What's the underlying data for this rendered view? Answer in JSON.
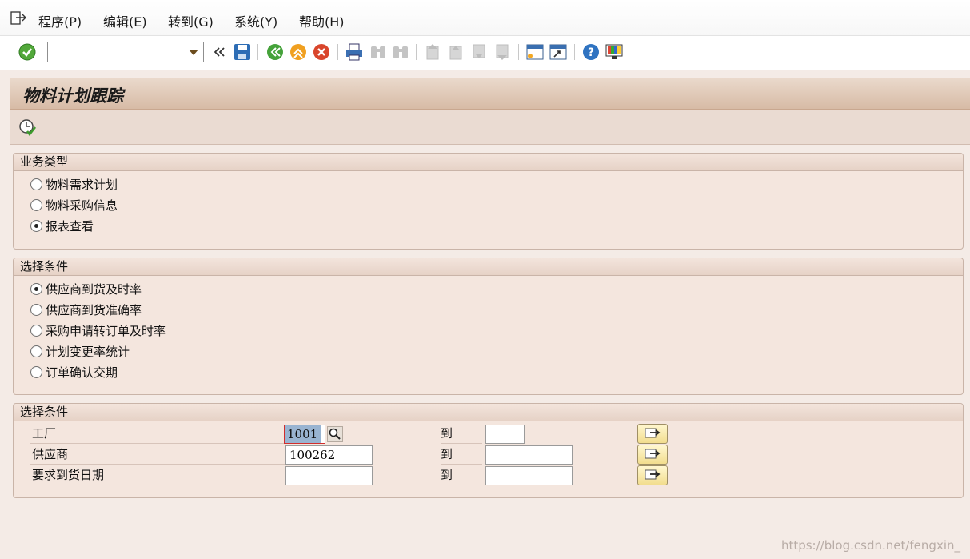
{
  "menubar": {
    "items": [
      "程序(P)",
      "编辑(E)",
      "转到(G)",
      "系统(Y)",
      "帮助(H)"
    ]
  },
  "toolbar": {
    "command_value": "",
    "icons": [
      "enter-icon",
      "back-icon",
      "save-icon",
      "back-green-icon",
      "exit-icon",
      "cancel-icon",
      "print-icon",
      "find-icon",
      "find-next-icon",
      "first-page-icon",
      "prev-page-icon",
      "next-page-icon",
      "last-page-icon",
      "new-session-icon",
      "shortcut-icon",
      "help-icon",
      "layout-icon"
    ]
  },
  "page": {
    "title": "物料计划跟踪",
    "execute_icon": "execute-icon"
  },
  "group_business": {
    "header": "业务类型",
    "options": [
      {
        "label": "物料需求计划",
        "checked": false
      },
      {
        "label": "物料采购信息",
        "checked": false
      },
      {
        "label": "报表查看",
        "checked": true
      }
    ]
  },
  "group_conditions": {
    "header": "选择条件",
    "options": [
      {
        "label": "供应商到货及时率",
        "checked": true
      },
      {
        "label": "供应商到货准确率",
        "checked": false
      },
      {
        "label": "采购申请转订单及时率",
        "checked": false
      },
      {
        "label": "计划变更率统计",
        "checked": false
      },
      {
        "label": "订单确认交期",
        "checked": false
      }
    ]
  },
  "group_criteria": {
    "header": "选择条件",
    "to_label": "到",
    "rows": [
      {
        "label": "工厂",
        "from": "1001",
        "to": ""
      },
      {
        "label": "供应商",
        "from": "100262",
        "to": ""
      },
      {
        "label": "要求到货日期",
        "from": "",
        "to": ""
      }
    ]
  },
  "watermark": "https://blog.csdn.net/fengxin_"
}
